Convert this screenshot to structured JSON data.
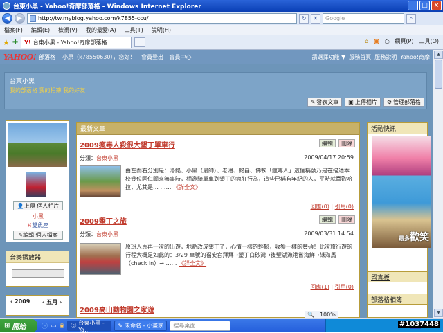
{
  "window": {
    "title": "台東小黑 - Yahoo!奇摩部落格 - Windows Internet Explorer"
  },
  "address": {
    "url": "http://tw.myblog.yahoo.com/k7855-ccu/",
    "search_placeholder": "Google"
  },
  "menu": [
    "檔案(F)",
    "編輯(E)",
    "檢視(V)",
    "我的最愛(A)",
    "工具(T)",
    "說明(H)"
  ],
  "tab": {
    "label": "台東小黑 - Yahoo!奇摩部落格"
  },
  "toolbar_right": {
    "page": "網頁(P)",
    "tools": "工具(O)"
  },
  "yahoo_bar": {
    "logo": "YAHOO!",
    "blog_label": "部落格",
    "user_greeting": "小原（k7855​0630），您好！",
    "logout": "會員登出",
    "member_center": "會員中心",
    "links": [
      "請選擇功能 ▼",
      "服務首頁",
      "服務說明",
      "Yahoo!奇摩"
    ]
  },
  "banner": {
    "title": "台東小黑",
    "subtitle": "我的部落格    我的相簿    我的好友",
    "buttons": {
      "post": "發表文章",
      "upload": "上傳相片",
      "manage": "管理部落格"
    }
  },
  "profile": {
    "upload_photo": "上傳 個人相片",
    "name": "小黑",
    "zodiac": "雙魚座",
    "edit_profile": "編輯 個人檔案"
  },
  "music": {
    "title": "音樂播放器"
  },
  "calendar": {
    "prev": "‹ 2009",
    "month": "‹ 五月 ›"
  },
  "center": {
    "header": "最新文章",
    "category_label": "分類：",
    "edit": "編輯",
    "delete": "刪除",
    "posts": [
      {
        "title": "2009瘋毒人殺很大墾丁單車行",
        "category": "台東小黑",
        "date": "2009/04/17 20:59",
        "body": "由左而右分別是：洛銘、小黑（最帥）、老潘、銘昌、佛軟「瘋毒人」這個稱號乃是在描述本校幾位同仁聞來無事時，相邀騎單車到墾丁的瘋狂行為，這些已稱有年紀的人，平時就喜歡哈拉，尤其是… ……",
        "more": "《詳全文》",
        "reply": "回應(0)",
        "trackback": "引用(0)"
      },
      {
        "title": "2009墾丁之旅",
        "category": "台東小黑",
        "date": "2009/03/31 14:54",
        "body": "原班人馬再一次的出遊，地點改成墾丁了，心情一樣的輕鬆，收獲一樣的豐碩！此次旅行遊的行程大概是如此的：3/29 車號的福安宮拜拜→墾丁白砂灣→後壁湖漁港嘗海鮮→綠海馬（check in）→ ……",
        "more": "《詳全文》",
        "reply": "回應(1)",
        "trackback": "引用(0)"
      },
      {
        "title": "2009高山動物園之家遊"
      }
    ]
  },
  "right": {
    "header": "活動快訊",
    "caption_small": "最多",
    "caption_big": "歡笑",
    "box1": "留言板",
    "box2": "部落格相簿"
  },
  "statusbar": {
    "zoom": "100%"
  },
  "taskbar": {
    "start": "開始",
    "tasks": [
      "台東小黑 - Ya...",
      "未命名 - 小畫家"
    ],
    "search_placeholder": "搜尋桌面",
    "lang": "CH",
    "watermark": "#1037448"
  },
  "colors": {
    "accent_red": "#c0392b",
    "page_bg": "#6d95b9",
    "panel_head": "#c7b168"
  }
}
